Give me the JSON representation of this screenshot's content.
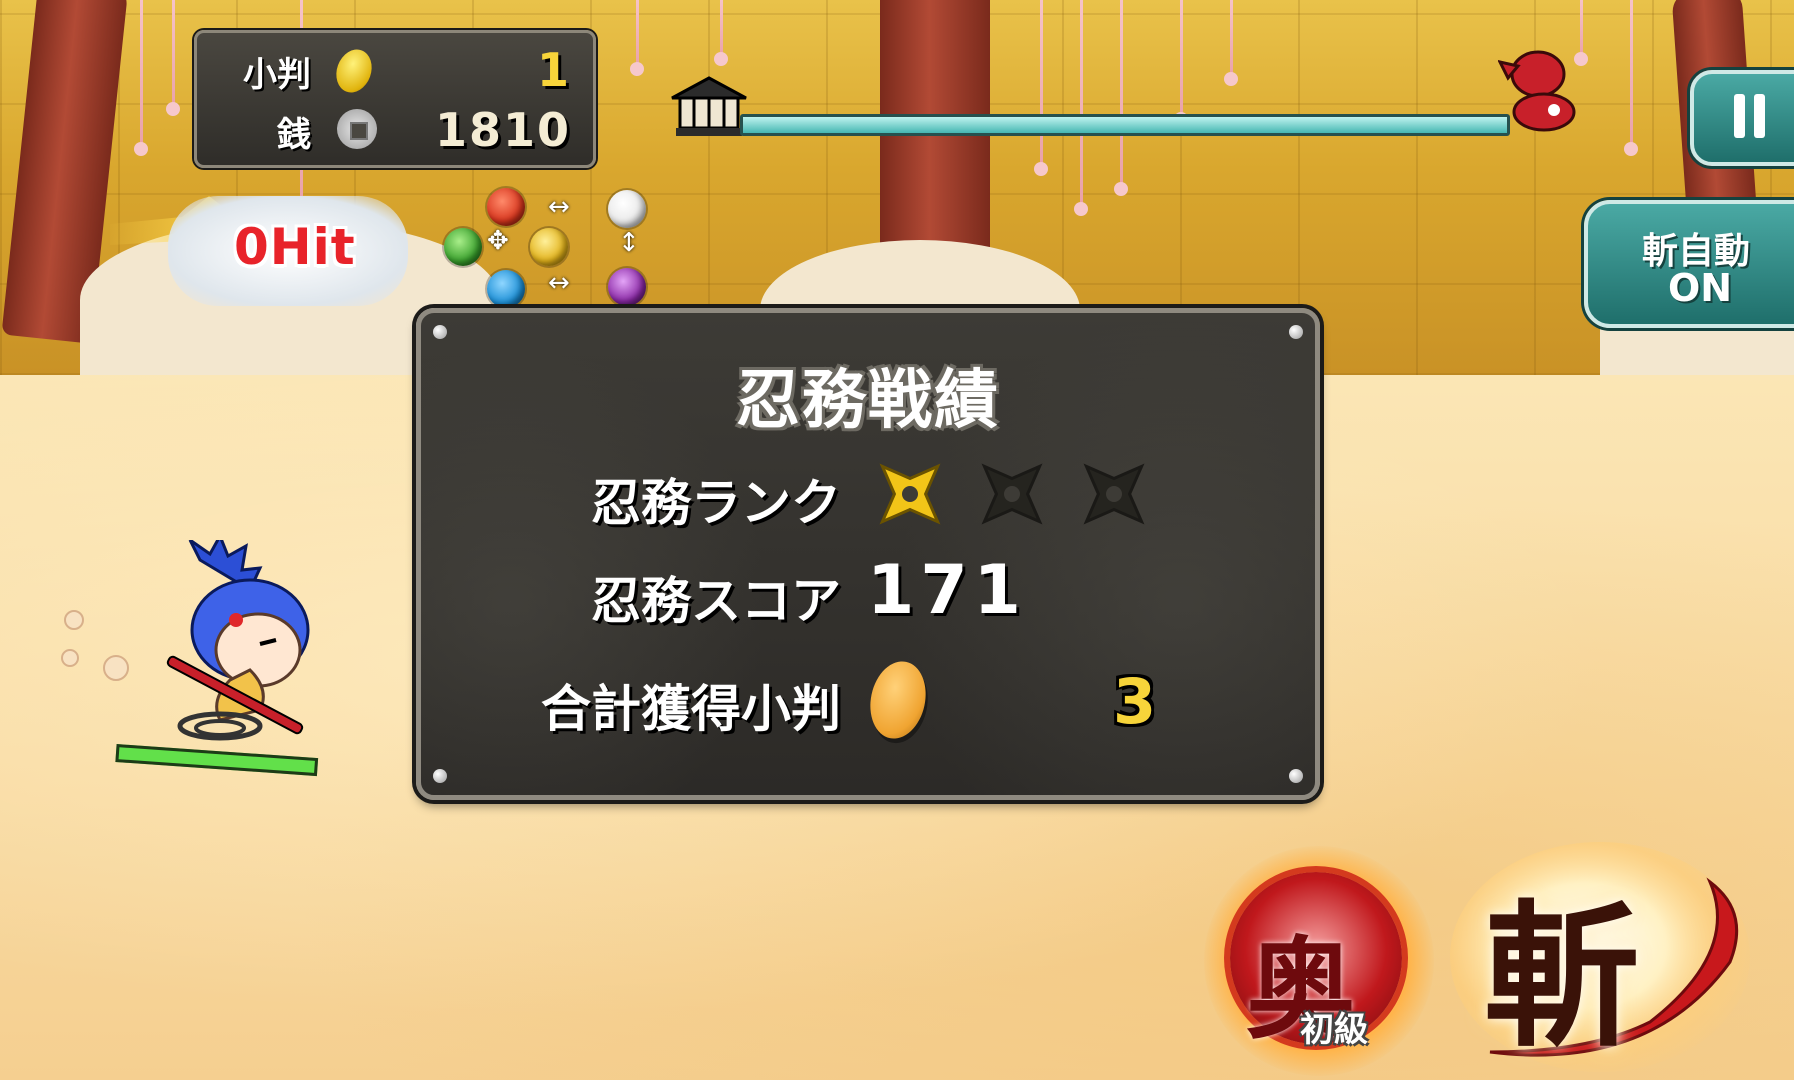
{
  "currency": {
    "koban_label": "小判",
    "koban_value": "1",
    "zeni_label": "銭",
    "zeni_value": "1810",
    "koban_icon": "koban-coin-icon",
    "zeni_icon": "zeni-coin-icon"
  },
  "stage_progress": {
    "start_icon": "house-icon",
    "goal_icon": "boss-icon",
    "progress": 1.0
  },
  "controls": {
    "pause_icon": "pause-icon",
    "auto_slash_line1": "斬自動",
    "auto_slash_line2": "ON"
  },
  "combo": {
    "hit_text": "0Hit"
  },
  "element_chart": {
    "orbs": [
      "fire",
      "wood",
      "earth",
      "water",
      "light",
      "dark"
    ],
    "colors": {
      "fire": "#d8361e",
      "wood": "#3aa12d",
      "earth": "#e2b21a",
      "water": "#1c8fd6",
      "light": "#f1f1f1",
      "dark": "#8b2aa6"
    }
  },
  "result": {
    "title": "忍務戦績",
    "rank_label": "忍務ランク",
    "rank_stars": 1,
    "rank_max": 3,
    "score_label": "忍務スコア",
    "score_value": "171",
    "total_label": "合計獲得小判",
    "total_value": "3"
  },
  "skills": {
    "skill_glyph": "奥",
    "skill_level": "初級",
    "slash_glyph": "斬"
  },
  "colors": {
    "panel": "#2f2d29",
    "accent_teal": "#2f8f8a",
    "gold": "#f7d43a",
    "hit_red": "#e8232a"
  }
}
